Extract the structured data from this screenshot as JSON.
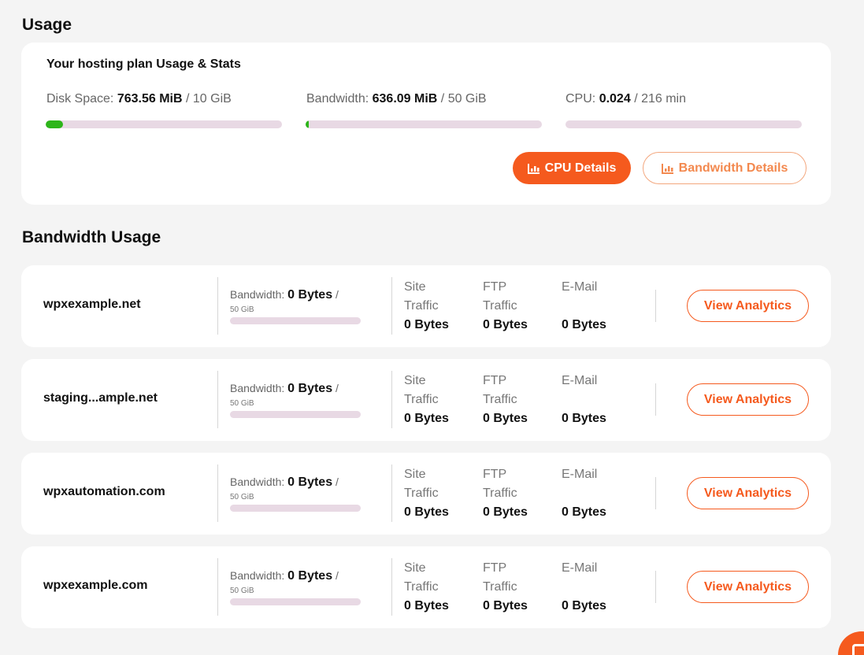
{
  "usage": {
    "title": "Usage",
    "subtitle": "Your hosting plan Usage & Stats",
    "stats": [
      {
        "label": "Disk Space:",
        "value": "763.56 MiB",
        "limit": "/ 10 GiB",
        "fraction": 0.073
      },
      {
        "label": "Bandwidth:",
        "value": "636.09 MiB",
        "limit": "/ 50 GiB",
        "fraction": 0.012
      },
      {
        "label": "CPU:",
        "value": "0.024",
        "limit": "/ 216 min",
        "fraction": 0.0
      }
    ],
    "cpu_button": "CPU Details",
    "bandwidth_button": "Bandwidth Details",
    "icon": "chart-bar-icon",
    "accent_color": "#f55a1e",
    "progress_color": "#2db51a"
  },
  "bandwidth": {
    "title": "Bandwidth Usage",
    "bandwidth_label": "Bandwidth:",
    "slash": "/",
    "site_traffic_label": [
      "Site",
      "Traffic"
    ],
    "ftp_traffic_label": [
      "FTP",
      "Traffic"
    ],
    "email_label": "E-Mail",
    "analytics_button": "View Analytics",
    "sites": [
      {
        "name": "wpxexample.net",
        "bandwidth": "0 Bytes",
        "limit": "50 GiB",
        "site_traffic": "0 Bytes",
        "ftp_traffic": "0 Bytes",
        "email": "0 Bytes"
      },
      {
        "name": "staging...ample.net",
        "bandwidth": "0 Bytes",
        "limit": "50 GiB",
        "site_traffic": "0 Bytes",
        "ftp_traffic": "0 Bytes",
        "email": "0 Bytes"
      },
      {
        "name": "wpxautomation.com",
        "bandwidth": "0 Bytes",
        "limit": "50 GiB",
        "site_traffic": "0 Bytes",
        "ftp_traffic": "0 Bytes",
        "email": "0 Bytes"
      },
      {
        "name": "wpxexample.com",
        "bandwidth": "0 Bytes",
        "limit": "50 GiB",
        "site_traffic": "0 Bytes",
        "ftp_traffic": "0 Bytes",
        "email": "0 Bytes"
      }
    ]
  }
}
